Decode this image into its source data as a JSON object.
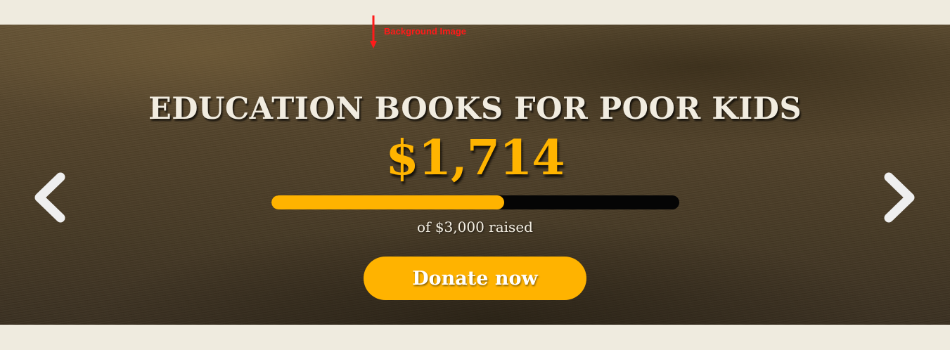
{
  "annotation": {
    "label": "Background Image",
    "color": "#ff1a1a"
  },
  "slider": {
    "prev_icon": "chevron-left-icon",
    "next_icon": "chevron-right-icon"
  },
  "campaign": {
    "title": "EDUCATION BOOKS FOR POOR KIDS",
    "raised": "$1,714",
    "goal_text": "of $3,000 raised",
    "progress_fraction": 0.571,
    "cta_label": "Donate now"
  },
  "colors": {
    "accent": "#ffb300",
    "page_background": "#efebdf",
    "title_text": "#f1ece0",
    "progress_track": "#050505"
  }
}
